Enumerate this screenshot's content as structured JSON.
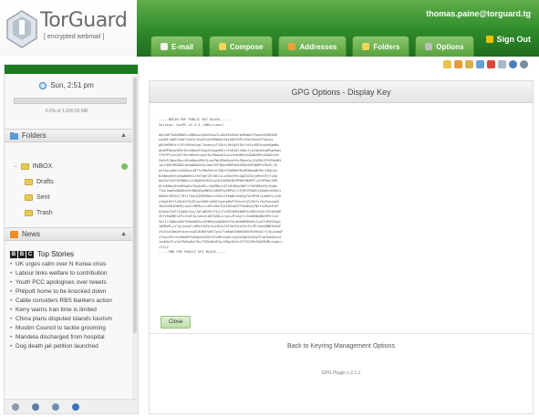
{
  "header": {
    "logo_name": "TorGuard",
    "logo_tag": "[ encrypted webmail ]",
    "user_email": "thomas.paine@torguard.tg",
    "signout_label": "Sign Out",
    "tabs": [
      {
        "label": "E-mail",
        "icon": "email-icon",
        "color": "#f2f2f2"
      },
      {
        "label": "Compose",
        "icon": "compose-icon",
        "color": "#f0d55a"
      },
      {
        "label": "Addresses",
        "icon": "addressbook-icon",
        "color": "#e8a23a"
      },
      {
        "label": "Folders",
        "icon": "folder-icon",
        "color": "#f0d55a"
      },
      {
        "label": "Options",
        "icon": "options-icon",
        "color": "#bcbcbc"
      }
    ]
  },
  "sidebar": {
    "clock": "Sun, 2:51 pm",
    "quota_text": "0.0% of 1,000.00 MB",
    "quota_fraction": 0,
    "folders_title": "Folders",
    "folders": [
      {
        "label": "INBOX",
        "sub": false
      },
      {
        "label": "Drafts",
        "sub": true
      },
      {
        "label": "Sent",
        "sub": true
      },
      {
        "label": "Trash",
        "sub": true
      }
    ],
    "news_title": "News",
    "news_brand": "Top Stories",
    "bbc_letters": [
      "B",
      "B",
      "C"
    ],
    "news": [
      "UK urges calm over N Korea crisis",
      "Labour links welfare to contribution",
      "Youth PCC apologises over tweets",
      "Philpott home to be knocked down",
      "Cable considers RBS bankers action",
      "Kerry warns Iran time is limited",
      "China plans disputed islands tourism",
      "Muslim Council to tackle grooming",
      "Mandela discharged from hospital",
      "Dog death jail petition launched"
    ]
  },
  "toolbar_icons": [
    "copy-icon",
    "contacts-icon",
    "key-icon",
    "calendar-icon",
    "bookmark-icon",
    "notes-icon",
    "settings-icon",
    "search-icon"
  ],
  "main": {
    "title": "GPG Options - Display Key",
    "key_text": "-----BEGIN PGP PUBLIC KEY BLOCK-----\nVersion: GnuPG v1.4.9 (GNU/Linux)\n\nmQGiBFfbAQRBACvvBBkxvnQGehSqw7s+8o9Ik9bAlqXHmWcTFkwexQIQE0kB\nnaaBIrgHEF4QATlbX3rJhwd7sUcRMb6gr6kihDGC6Pvt9aS5nhu87hqiex\ngDShMSMrkfj9Fc9RhkXvgCJhsbnyyTSGktjHvSg5f5hlfe5v4GPSwukeQgmWs\ndkwMPUkxqSRGrEecd0wn6ZkqsGfApgeHGrJ2v6G6ltbQnfjpYaKoHvqPkgRkmv\nY7eYPlivnAhTtRvuWSxhnymyl6wTWwkmSIw1oJUeHHOlHuDbB20Rvd3wOhcEk\nZxDxP/NdxQ0xrsMnbBpuUMU/K+mcPWrDMsMnzhh9zP0ouGyjZ4ZEKJFVFR6dK9\njdcCBOlHRD6D2i0aqDA8S6Q1Jmq76VT0QoHGKPsBXG9X6JNFQ6WPvF8cEL/W\nwXt6p+o6dLZuE05pnJB77oPNs9ehXlf8QfGJb9B8tMi8R9WeqNFBk/LBqLQn\nBJmWnyDthnXhw6DWtGz7bTqEr4F1NtJ+LoX6ntR9zGgDIOS6jyMe5CHjf+0p\nmwV3zfoSY8YRm0yLnl0qQK6tH53zg1A4tkMdiBLMPWnFNUNPY+xPdPHp2JGM\nQLsHH8gjDhnDhkgDv3UyAuM1+r4pM0bjLQTxHt8KpfWbTcfUe5MUwFb/HdAm\nT7pL5mqVkNmD8zhDrN6pQQgUNG5Ja6hM7gV0Pnh/29jBYFDbDCn48q0tsRbkLs\n8DbRcIEEXV/7RfjT6eLQZHRZ60wrc3VuLGFkbWluOdIgrVb3Pf6+1p60tV+ZuR\nnJ0gIHhYTz8L62Y6jB7yeZb6QlsWOlXyphpHsPYGHczZ+RJGh7zr5y9sedaA3\n3bQ34kR1hWH9j+QqlvMP0ucrc05uGAt7Ga1DSnQGZTkUAKpG/N2fn2DsmZhbT\nA2mdvCZnPlIwOQhtGx/IaCaN19SrTkJj7zHGS3KRe6KHfLO8UYZGH+SIVXDdQR\nZh7x9aXNEiXFsrSdFJo/ubxvlQQTmGD+vrp1+ZFsAyrv/Da6kNoN82HPeY+kr\n3xC1lCbWwuUOVf58ak80Xzy5VNHdywQbKN3n7kcaHdkM9Rm6sJ+wF2zPGS0pgl\nJgMQUR+ziTg/yxwpl+qMxt4yEprpuJQ1xZXT5mIGkuC6zZs/MlfghoDN69eAvF\n2tUIsaCWapEfazkxsqSC8UNVfoBf7yxLFcbRg0IkWmGSBk95o9yqCrV/QuiUaoF\nIfspJnPzrKy0dd8PSoPqkd1U2KY3Yw5Dfag9LcypGnSg0tXh2qTSuqYpdg5xu3\n1zwKAnTLzfm79d9g8uC9kcTEZUaB4E3a/ORqr6aYzSTYSGCMvfAQEBJMzlaqw==\n=Y2jZ\n-----END PGP PUBLIC KEY BLOCK-----",
    "close_label": "Close",
    "back_link": "Back to Keyring Management Options",
    "plugin_version": "GPG Plugin v 2.1.1"
  }
}
